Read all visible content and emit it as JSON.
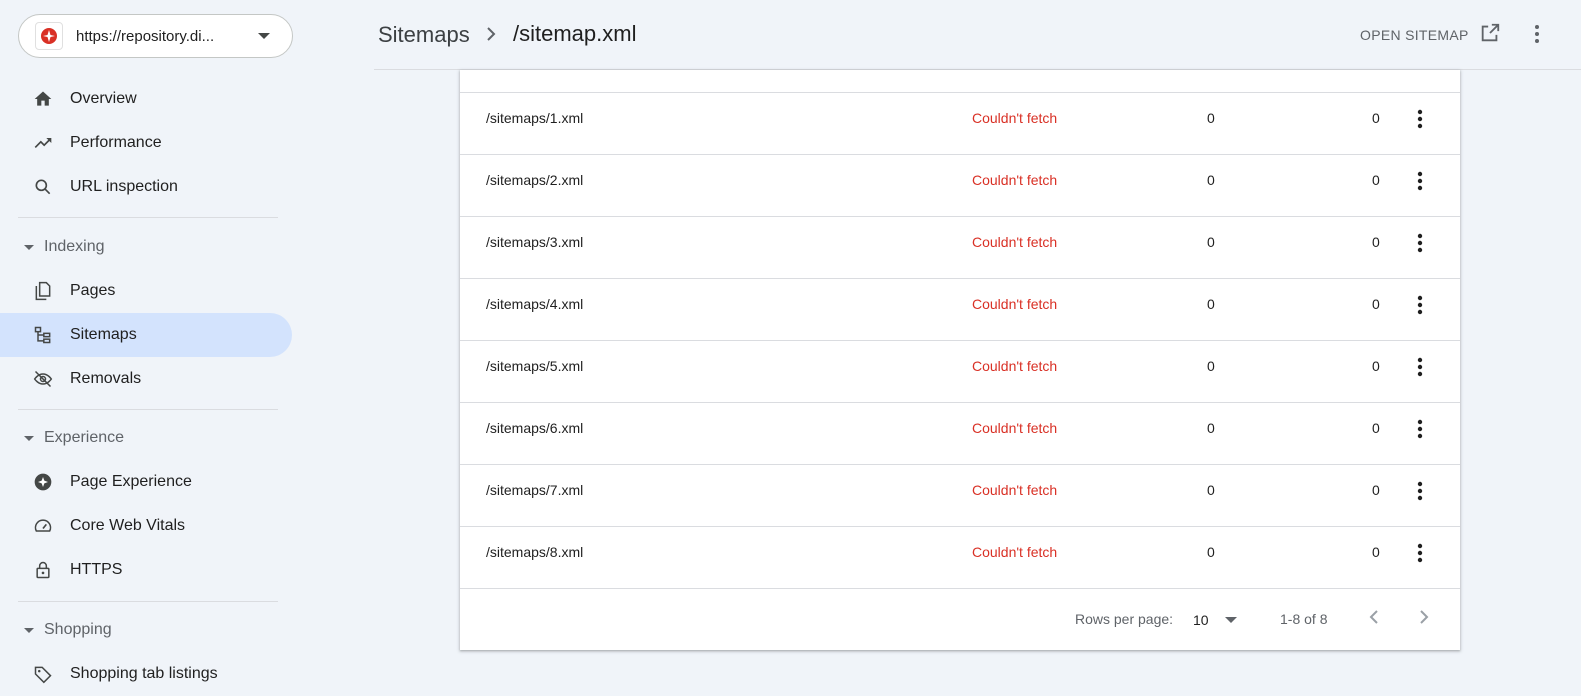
{
  "property": {
    "url": "https://repository.di...",
    "logo_color": "#d93025"
  },
  "nav": {
    "overview": "Overview",
    "performance": "Performance",
    "url_inspection": "URL inspection",
    "indexing_section": "Indexing",
    "pages": "Pages",
    "sitemaps": "Sitemaps",
    "removals": "Removals",
    "experience_section": "Experience",
    "page_experience": "Page Experience",
    "core_web_vitals": "Core Web Vitals",
    "https": "HTTPS",
    "shopping_section": "Shopping",
    "shopping_tab_listings": "Shopping tab listings"
  },
  "header": {
    "crumb_root": "Sitemaps",
    "crumb_current": "/sitemap.xml",
    "open_sitemap": "OPEN SITEMAP"
  },
  "table": {
    "rows": [
      {
        "path": "/sitemaps/1.xml",
        "status": "Couldn't fetch",
        "col_a": "0",
        "col_b": "0"
      },
      {
        "path": "/sitemaps/2.xml",
        "status": "Couldn't fetch",
        "col_a": "0",
        "col_b": "0"
      },
      {
        "path": "/sitemaps/3.xml",
        "status": "Couldn't fetch",
        "col_a": "0",
        "col_b": "0"
      },
      {
        "path": "/sitemaps/4.xml",
        "status": "Couldn't fetch",
        "col_a": "0",
        "col_b": "0"
      },
      {
        "path": "/sitemaps/5.xml",
        "status": "Couldn't fetch",
        "col_a": "0",
        "col_b": "0"
      },
      {
        "path": "/sitemaps/6.xml",
        "status": "Couldn't fetch",
        "col_a": "0",
        "col_b": "0"
      },
      {
        "path": "/sitemaps/7.xml",
        "status": "Couldn't fetch",
        "col_a": "0",
        "col_b": "0"
      },
      {
        "path": "/sitemaps/8.xml",
        "status": "Couldn't fetch",
        "col_a": "0",
        "col_b": "0"
      }
    ],
    "status_color": "#d93025"
  },
  "pagination": {
    "rows_per_page_label": "Rows per page:",
    "rows_per_page_value": "10",
    "range": "1-8 of 8"
  },
  "colors": {
    "active_nav_bg": "#d3e3fd",
    "page_bg": "#f0f4f9"
  }
}
